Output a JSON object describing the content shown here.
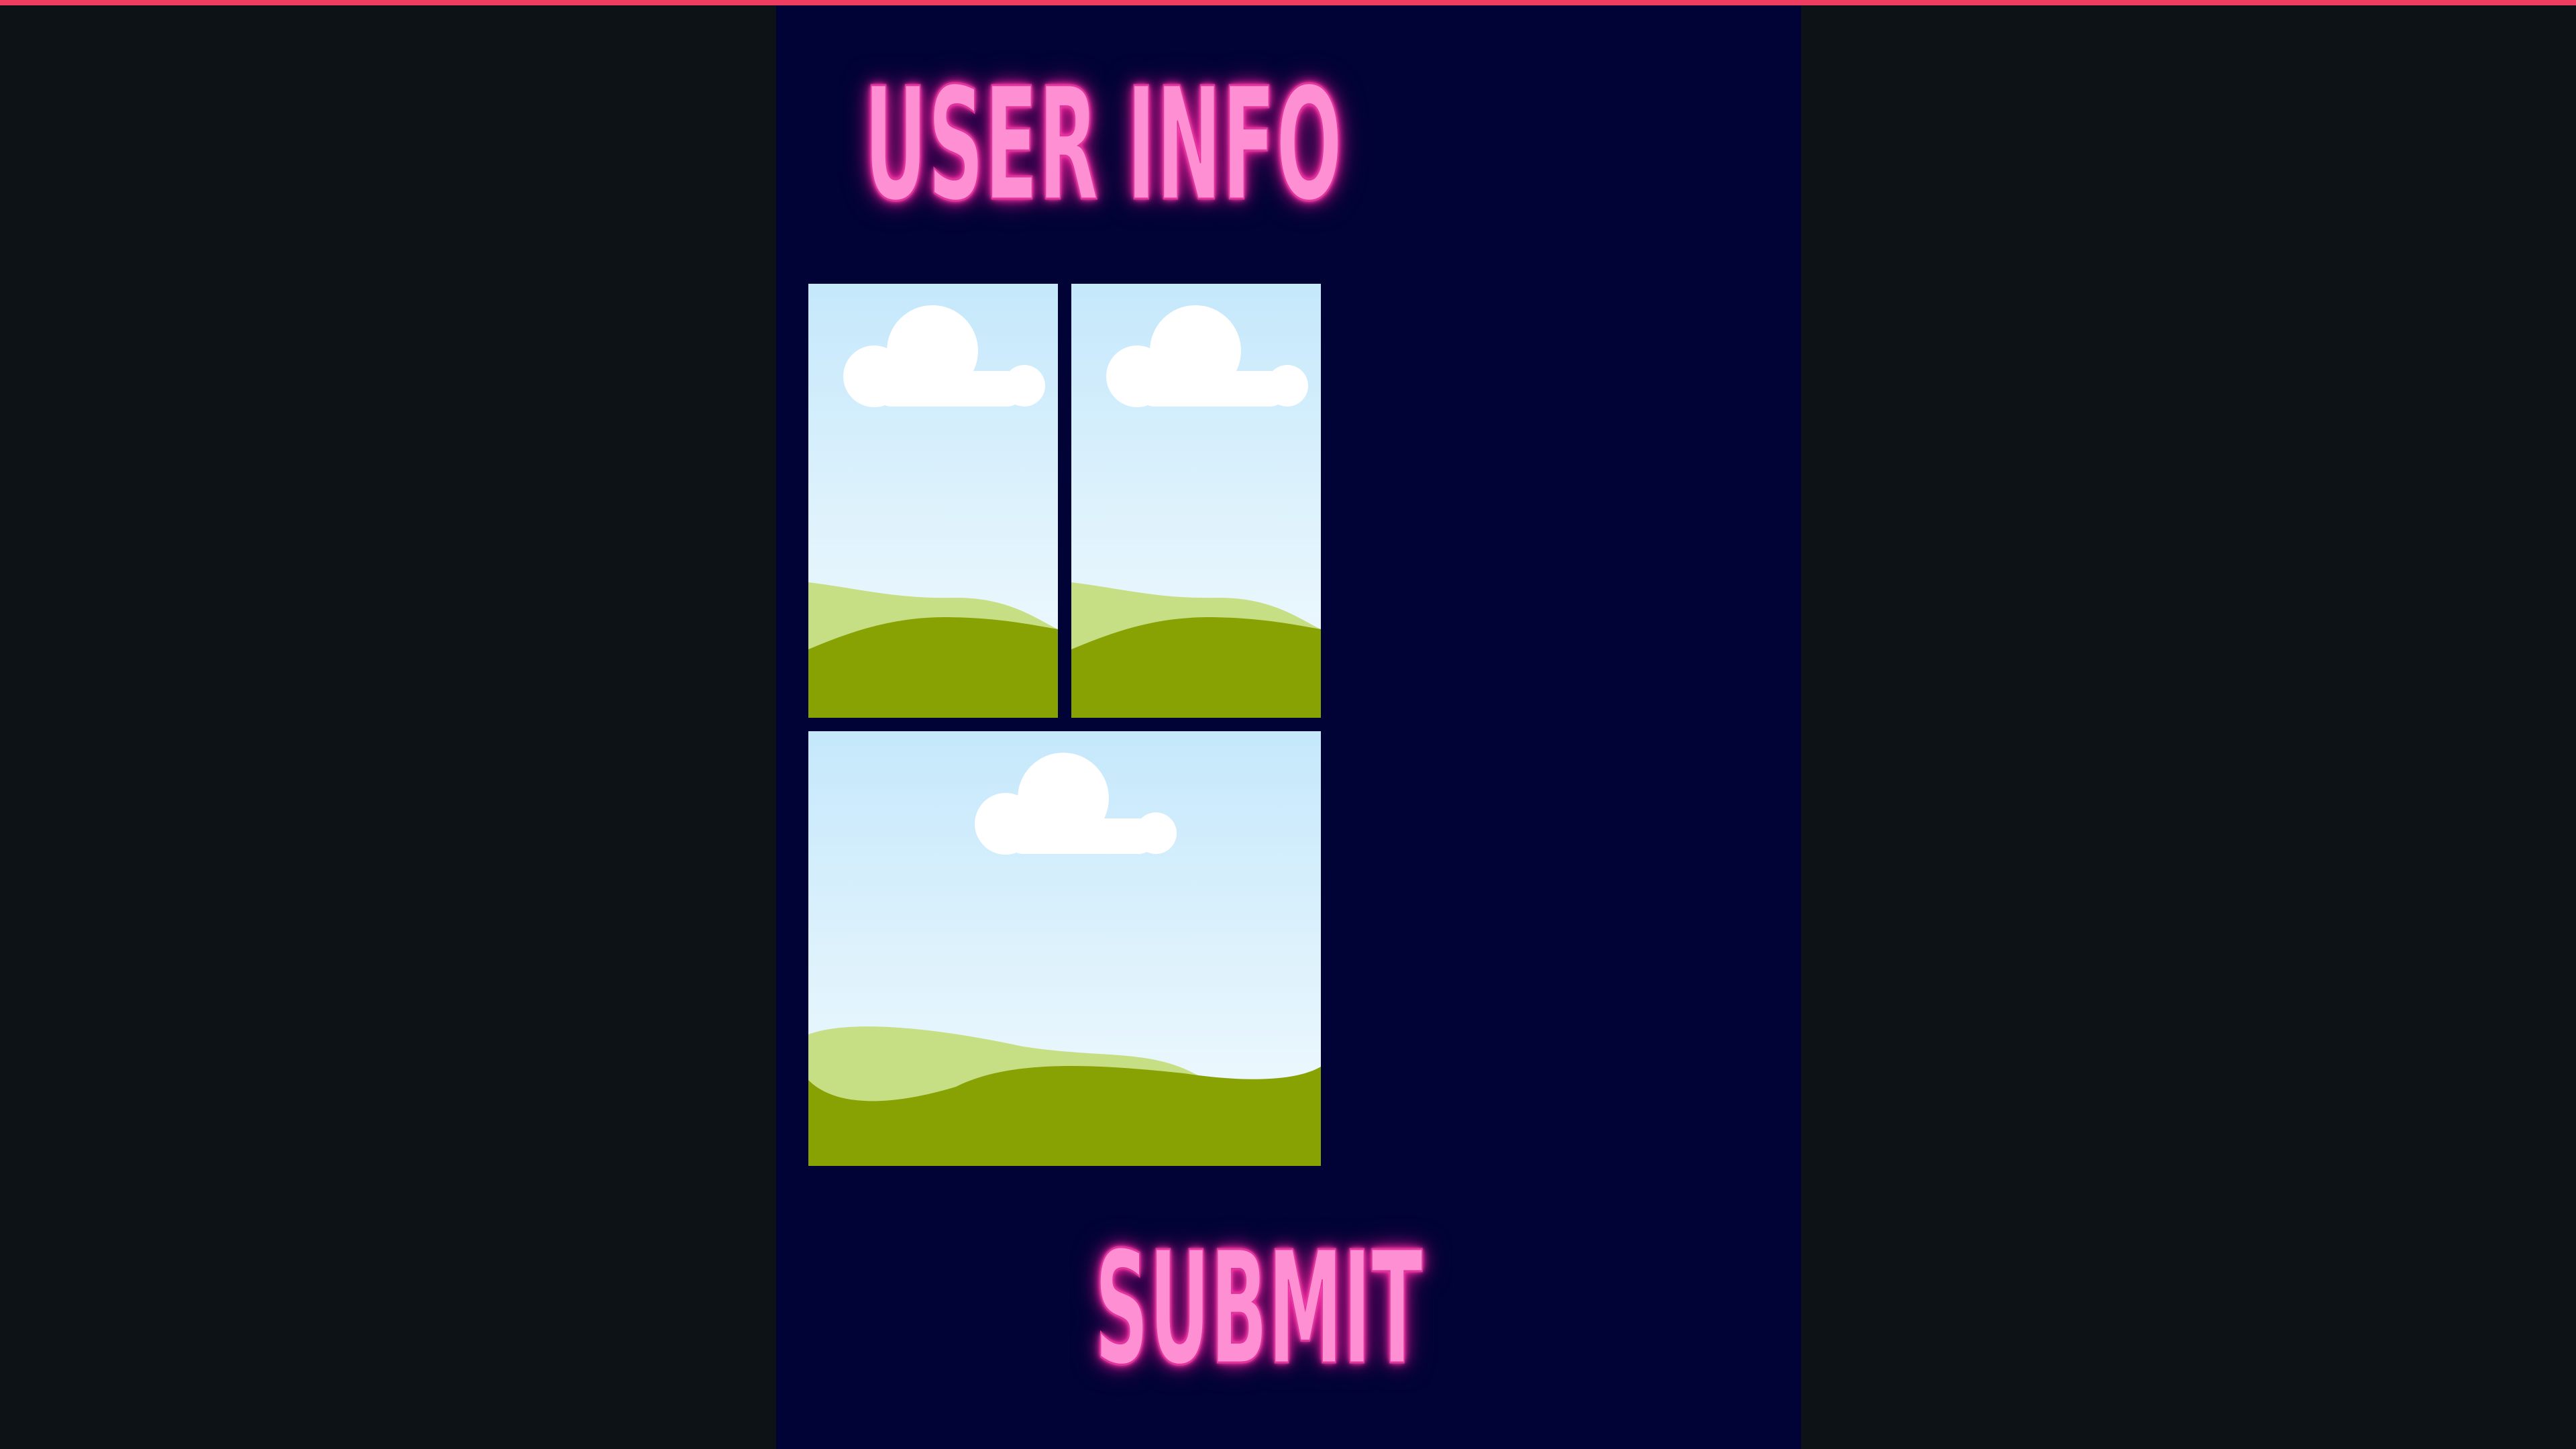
{
  "header": {
    "logo_icon": "pink-tab-logo-icon",
    "accent_color": "#ef3d62"
  },
  "form": {
    "title": "USER INFO",
    "submit_label": "SUBMIT",
    "text_color": "#ff8fd3",
    "background_color": "#010336"
  },
  "gallery": {
    "images": [
      {
        "icon": "landscape-placeholder-icon"
      },
      {
        "icon": "landscape-placeholder-icon"
      },
      {
        "icon": "landscape-placeholder-icon"
      }
    ]
  }
}
